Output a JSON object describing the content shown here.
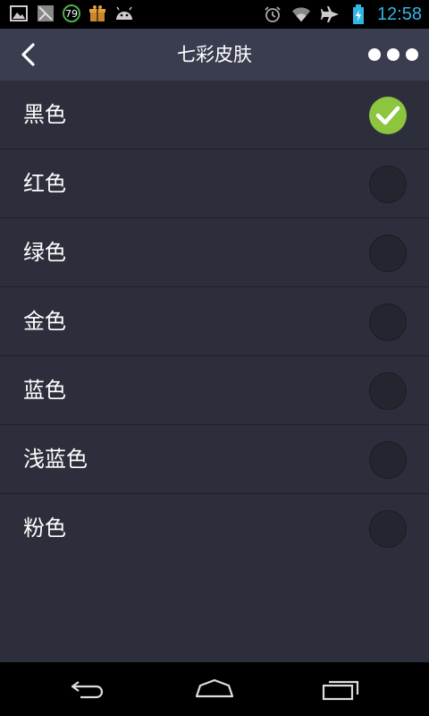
{
  "status_bar": {
    "badge_number": "79",
    "time": "12:58",
    "left_icons": [
      "gallery-icon",
      "image-notification-icon",
      "badge-79-icon",
      "gift-box-icon",
      "android-icon"
    ],
    "right_icons": [
      "alarm-icon",
      "wifi-icon",
      "airplane-icon",
      "battery-charging-icon"
    ]
  },
  "header": {
    "title": "七彩皮肤",
    "back_icon": "chevron-left-icon",
    "more_icon": "more-dots-icon"
  },
  "skins": [
    {
      "label": "黑色",
      "selected": true
    },
    {
      "label": "红色",
      "selected": false
    },
    {
      "label": "绿色",
      "selected": false
    },
    {
      "label": "金色",
      "selected": false
    },
    {
      "label": "蓝色",
      "selected": false
    },
    {
      "label": "浅蓝色",
      "selected": false
    },
    {
      "label": "粉色",
      "selected": false
    }
  ],
  "colors": {
    "background": "#2c2e3b",
    "header": "#3a3d4f",
    "check_accent": "#8cc63f",
    "time_text": "#33b5e5"
  },
  "nav": {
    "buttons": [
      "back-nav-icon",
      "home-nav-icon",
      "recents-nav-icon"
    ]
  }
}
